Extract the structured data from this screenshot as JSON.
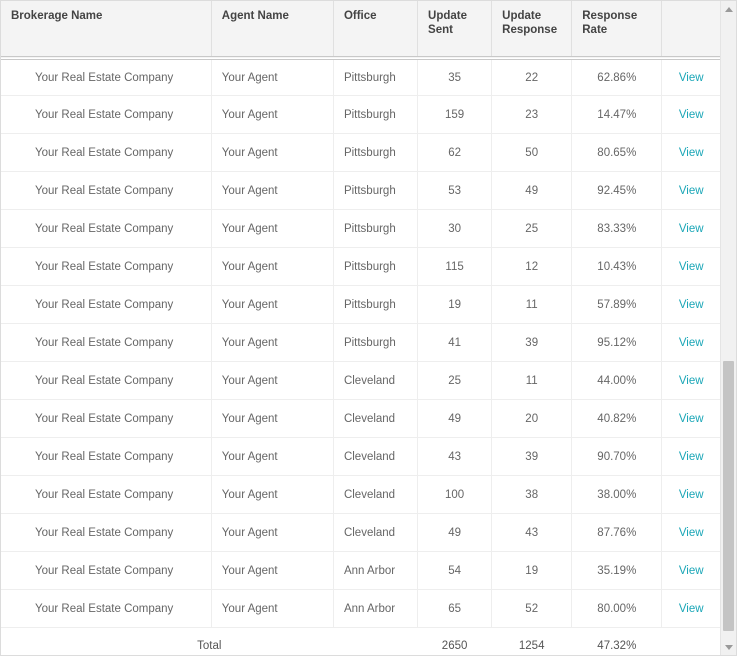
{
  "table": {
    "headers": {
      "brokerage": "Brokerage Name",
      "agent": "Agent Name",
      "office": "Office",
      "sent": "Update Sent",
      "response": "Update Response",
      "rate": "Response Rate",
      "action": ""
    },
    "action_label": "View",
    "rows": [
      {
        "brokerage": "Your Real Estate Company",
        "agent": "Your Agent",
        "office": "Pittsburgh",
        "sent": "35",
        "response": "22",
        "rate": "62.86%"
      },
      {
        "brokerage": "Your Real Estate Company",
        "agent": "Your Agent",
        "office": "Pittsburgh",
        "sent": "159",
        "response": "23",
        "rate": "14.47%"
      },
      {
        "brokerage": "Your Real Estate Company",
        "agent": "Your Agent",
        "office": "Pittsburgh",
        "sent": "62",
        "response": "50",
        "rate": "80.65%"
      },
      {
        "brokerage": "Your Real Estate Company",
        "agent": "Your Agent",
        "office": "Pittsburgh",
        "sent": "53",
        "response": "49",
        "rate": "92.45%"
      },
      {
        "brokerage": "Your Real Estate Company",
        "agent": "Your Agent",
        "office": "Pittsburgh",
        "sent": "30",
        "response": "25",
        "rate": "83.33%"
      },
      {
        "brokerage": "Your Real Estate Company",
        "agent": "Your Agent",
        "office": "Pittsburgh",
        "sent": "115",
        "response": "12",
        "rate": "10.43%"
      },
      {
        "brokerage": "Your Real Estate Company",
        "agent": "Your Agent",
        "office": "Pittsburgh",
        "sent": "19",
        "response": "11",
        "rate": "57.89%"
      },
      {
        "brokerage": "Your Real Estate Company",
        "agent": "Your Agent",
        "office": "Pittsburgh",
        "sent": "41",
        "response": "39",
        "rate": "95.12%"
      },
      {
        "brokerage": "Your Real Estate Company",
        "agent": "Your Agent",
        "office": "Cleveland",
        "sent": "25",
        "response": "11",
        "rate": "44.00%"
      },
      {
        "brokerage": "Your Real Estate Company",
        "agent": "Your Agent",
        "office": "Cleveland",
        "sent": "49",
        "response": "20",
        "rate": "40.82%"
      },
      {
        "brokerage": "Your Real Estate Company",
        "agent": "Your Agent",
        "office": "Cleveland",
        "sent": "43",
        "response": "39",
        "rate": "90.70%"
      },
      {
        "brokerage": "Your Real Estate Company",
        "agent": "Your Agent",
        "office": "Cleveland",
        "sent": "100",
        "response": "38",
        "rate": "38.00%"
      },
      {
        "brokerage": "Your Real Estate Company",
        "agent": "Your Agent",
        "office": "Cleveland",
        "sent": "49",
        "response": "43",
        "rate": "87.76%"
      },
      {
        "brokerage": "Your Real Estate Company",
        "agent": "Your Agent",
        "office": "Ann Arbor",
        "sent": "54",
        "response": "19",
        "rate": "35.19%"
      },
      {
        "brokerage": "Your Real Estate Company",
        "agent": "Your Agent",
        "office": "Ann Arbor",
        "sent": "65",
        "response": "52",
        "rate": "80.00%"
      }
    ],
    "totals": {
      "label": "Total",
      "sent": "2650",
      "response": "1254",
      "rate": "47.32%"
    }
  }
}
